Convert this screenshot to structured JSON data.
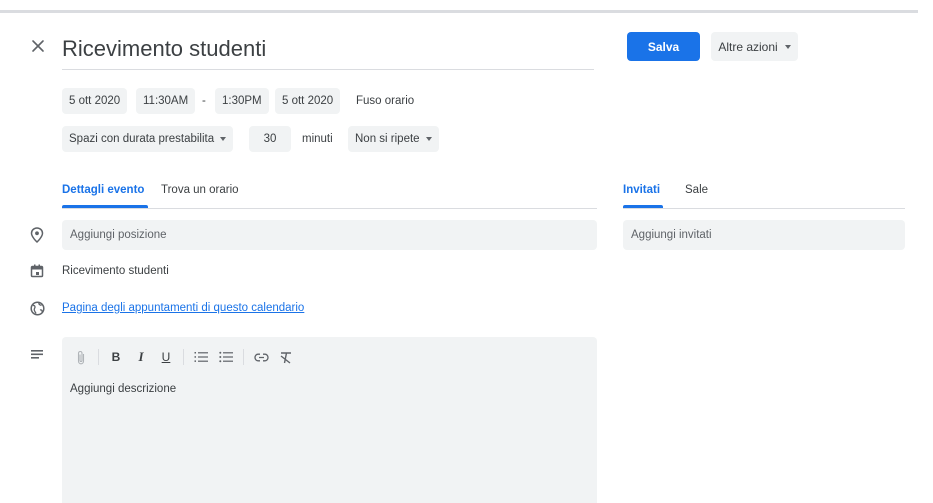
{
  "event": {
    "title": "Ricevimento studenti",
    "save_label": "Salva",
    "more_actions_label": "Altre azioni"
  },
  "datetime": {
    "start_date": "5 ott 2020",
    "start_time": "11:30AM",
    "separator": "-",
    "end_time": "1:30PM",
    "end_date": "5 ott 2020",
    "timezone_label": "Fuso orario"
  },
  "slots": {
    "type_label": "Spazi con durata prestabilita",
    "duration_value": "30",
    "duration_unit": "minuti",
    "recurrence_label": "Non si ripete"
  },
  "tabs": {
    "details": "Dettagli evento",
    "find_time": "Trova un orario"
  },
  "side_tabs": {
    "guests": "Invitati",
    "rooms": "Sale"
  },
  "fields": {
    "location_placeholder": "Aggiungi posizione",
    "calendar_name": "Ricevimento studenti",
    "appointments_link": "Pagina degli appuntamenti di questo calendario",
    "guests_placeholder": "Aggiungi invitati",
    "description_placeholder": "Aggiungi descrizione"
  },
  "toolbar": {
    "bold": "B",
    "italic": "I",
    "underline": "U"
  },
  "icons": {
    "close": "close-icon",
    "location": "location-pin-icon",
    "calendar": "calendar-icon",
    "globe": "globe-icon",
    "description": "notes-icon",
    "attach": "paperclip-icon",
    "numbered_list": "numbered-list-icon",
    "bulleted_list": "bulleted-list-icon",
    "link": "link-icon",
    "clear_format": "clear-formatting-icon"
  },
  "colors": {
    "accent": "#1a73e8",
    "chip_bg": "#f1f3f4",
    "text": "#3c4043",
    "icon": "#5f6368"
  }
}
